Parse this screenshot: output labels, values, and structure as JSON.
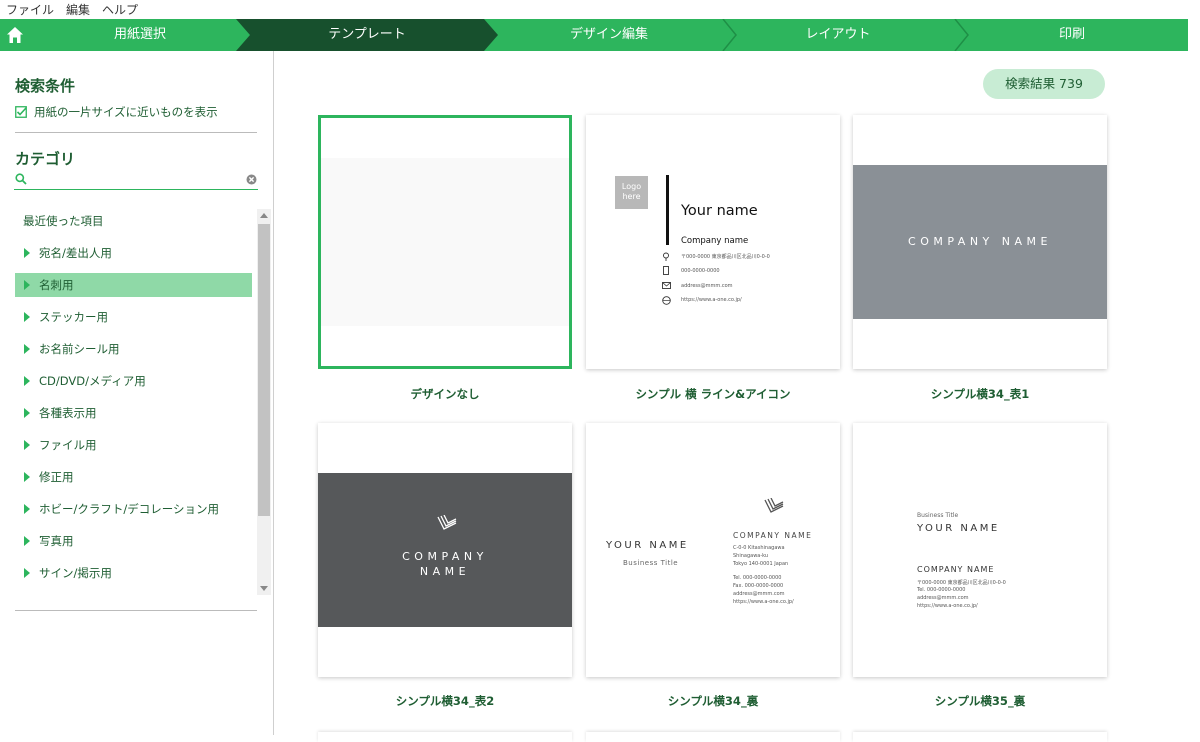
{
  "menu": [
    "ファイル",
    "編集",
    "ヘルプ"
  ],
  "steps": [
    "用紙選択",
    "テンプレート",
    "デザイン編集",
    "レイアウト",
    "印刷"
  ],
  "active_step": 1,
  "sidebar": {
    "search_title": "検索条件",
    "checkbox_label": "用紙の一片サイズに近いものを表示",
    "category_title": "カテゴリ",
    "category_search_placeholder": "",
    "items": [
      {
        "label": "最近使った項目",
        "recent": true
      },
      {
        "label": "宛名/差出人用"
      },
      {
        "label": "名刺用",
        "selected": true
      },
      {
        "label": "ステッカー用"
      },
      {
        "label": "お名前シール用"
      },
      {
        "label": "CD/DVD/メディア用"
      },
      {
        "label": "各種表示用"
      },
      {
        "label": "ファイル用"
      },
      {
        "label": "修正用"
      },
      {
        "label": "ホビー/クラフト/デコレーション用"
      },
      {
        "label": "写真用"
      },
      {
        "label": "サイン/掲示用"
      }
    ]
  },
  "results": {
    "label": "検索結果 739"
  },
  "templates": [
    {
      "caption": "デザインなし"
    },
    {
      "caption": "シンプル 横 ライン&アイコン",
      "logo_line1": "Logo",
      "logo_line2": "here",
      "name": "Your name",
      "company": "Company name",
      "postal": "〒000-0000 東京都品川区北品川0-0-0",
      "phone": "000-0000-0000",
      "email": "address@mmm.com",
      "web": "https://www.a-one.co.jp/"
    },
    {
      "caption": "シンプル横34_表1",
      "company": "COMPANY NAME"
    },
    {
      "caption": "シンプル横34_表2",
      "company_line1": "COMPANY",
      "company_line2": "NAME"
    },
    {
      "caption": "シンプル横34_裏",
      "name": "YOUR NAME",
      "title": "Business Title",
      "company": "COMPANY NAME",
      "addr1": "C-0-0 Kitashinagawa",
      "addr2": "Shinagawa-ku",
      "addr3": "Tokyo 140-0001 Japan",
      "tel": "Tel. 000-0000-0000",
      "fax": "Fax. 000-0000-0000",
      "email": "address@mmm.com",
      "web": "https://www.a-one.co.jp/"
    },
    {
      "caption": "シンプル横35_裏",
      "title": "Business Title",
      "name": "YOUR NAME",
      "company": "COMPANY NAME",
      "addr": "〒000-0000 東京都品川区北品川0-0-0",
      "tel": "Tel. 000-0000-0000",
      "email": "address@mmm.com",
      "web": "https://www.a-one.co.jp/"
    }
  ],
  "colors": {
    "accent": "#2db55d",
    "dark": "#17502d",
    "selected": "#8fd9a7"
  }
}
